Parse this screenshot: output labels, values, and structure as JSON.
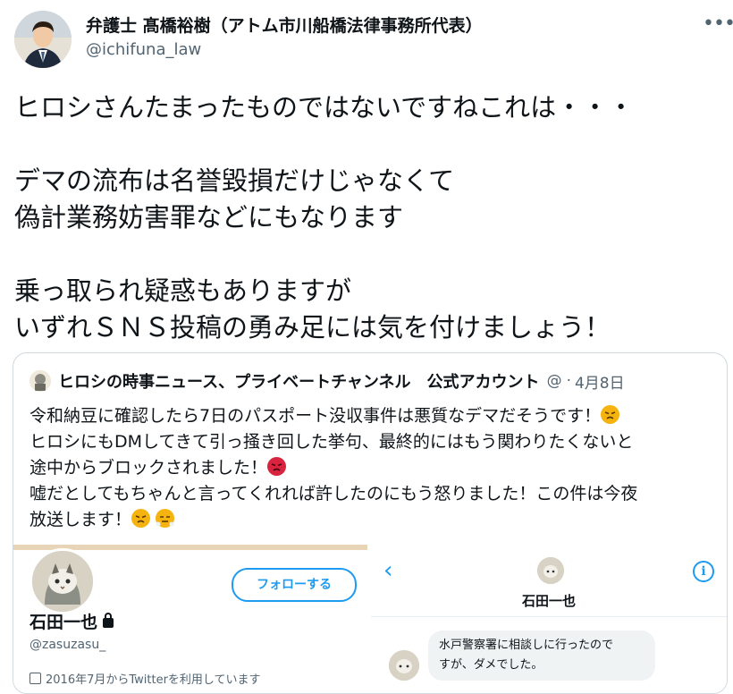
{
  "author": {
    "name": "弁護士 髙橋裕樹（アトム市川船橋法律事務所代表）",
    "handle": "@ichifuna_law"
  },
  "tweet": {
    "text": "ヒロシさんたまったものではないですねこれは・・・\n\nデマの流布は名誉毀損だけじゃなくて\n偽計業務妨害罪などにもなります\n\n乗っ取られ疑惑もありますが\nいずれＳＮＳ投稿の勇み足には気を付けましょう！"
  },
  "quote": {
    "name": "ヒロシの時事ニュース、プライベートチャンネル　公式アカウント",
    "handle": "@",
    "sep": "·",
    "date": "4月8日",
    "line1": "令和納豆に確認したら7日のパスポート没収事件は悪質なデマだそうです！",
    "line2": "ヒロシにもDMしてきて引っ掻き回した挙句、最終的にはもう関わりたくないと",
    "line3": "途中からブロックされました！",
    "line4": "嘘だとしてもちゃんと言ってくれれば許したのにもう怒りました！この件は今夜",
    "line5": "放送します！"
  },
  "profile_shot": {
    "follow_label": "フォローする",
    "name": "石田一也",
    "handle": "@zasuzasu_",
    "joined": "2016年7月からTwitterを利用しています"
  },
  "dm_shot": {
    "name": "石田一也",
    "message": "水戸警察署に相談しに行ったので\nすが、ダメでした。"
  },
  "colors": {
    "accent": "#1d9bf0",
    "secondary_text": "#536471",
    "border": "#cfd9de"
  }
}
